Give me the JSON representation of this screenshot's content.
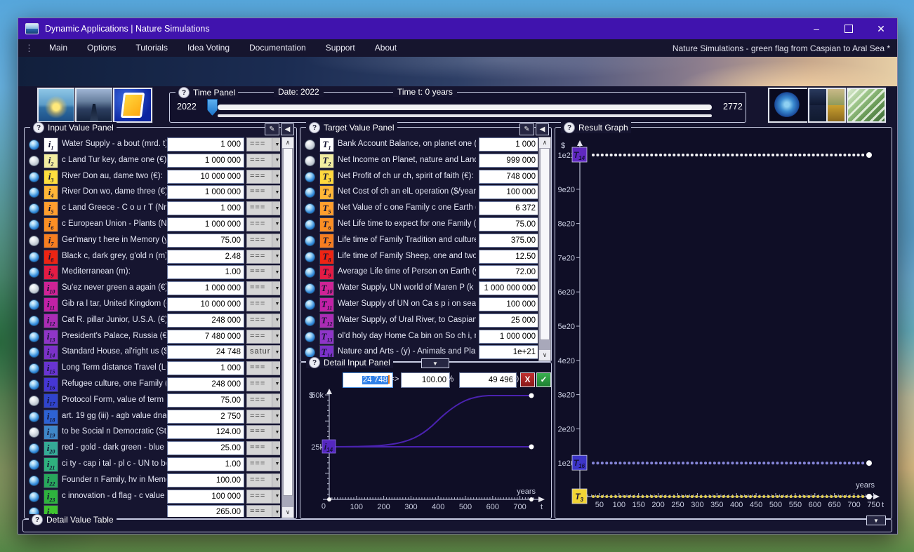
{
  "window": {
    "title": "Dynamic Applications | Nature Simulations",
    "controls": {
      "minimize": "–",
      "close": "✕"
    },
    "menu": {
      "items": [
        "Main",
        "Options",
        "Tutorials",
        "Idea Voting",
        "Documentation",
        "Support",
        "About"
      ],
      "right_text": "Nature Simulations - green flag from Caspian to Aral Sea *"
    }
  },
  "toolbar": {
    "left_thumbnails": [
      "sunset-sea-photo",
      "pier-photo",
      "dynamic-applications-logo"
    ],
    "right_thumbnails": [
      "earth-photo",
      "four-image-collage",
      "green-architecture-photo"
    ]
  },
  "time_panel": {
    "title": "Time Panel",
    "date": "Date: 2022",
    "time": "Time t: 0 years",
    "start": "2022",
    "end": "2772"
  },
  "input_panel": {
    "title": "Input Value Panel",
    "rows": [
      {
        "icon": "i",
        "index": 1,
        "color": "#ffffff",
        "label": "Water Supply - a bout (mrd. t):",
        "value": "1 000",
        "mode": "===",
        "selected": true
      },
      {
        "icon": "i",
        "index": 2,
        "color": "#f2eda0",
        "label": "c Land Tur key, dame one (€):",
        "value": "1 000 000",
        "mode": "===",
        "selected": false
      },
      {
        "icon": "i",
        "index": 3,
        "color": "#ffdf3e",
        "label": "River Don au, dame two (€):",
        "value": "10 000 000",
        "mode": "===",
        "selected": true
      },
      {
        "icon": "i",
        "index": 4,
        "color": "#ffb637",
        "label": "River Don wo, dame three (€):",
        "value": "1 000 000",
        "mode": "===",
        "selected": true
      },
      {
        "icon": "i",
        "index": 5,
        "color": "#ff9e2e",
        "label": "c Land Greece - C o u r T (Nr):",
        "value": "1 000",
        "mode": "===",
        "selected": true
      },
      {
        "icon": "i",
        "index": 6,
        "color": "#fb8f24",
        "label": "c European Union - Plants (Nr):",
        "value": "1 000 000",
        "mode": "===",
        "selected": true
      },
      {
        "icon": "i",
        "index": 7,
        "color": "#f57e20",
        "label": "Ger'many t here in Memory (year",
        "value": "75.00",
        "mode": "===",
        "selected": false
      },
      {
        "icon": "i",
        "index": 8,
        "color": "#ee2413",
        "label": "Black c, dark grey, g'old n (m):",
        "value": "2.48",
        "mode": "===",
        "selected": true
      },
      {
        "icon": "i",
        "index": 9,
        "color": "#e31b44",
        "label": "Mediterranean (m):",
        "value": "1.00",
        "mode": "===",
        "selected": true
      },
      {
        "icon": "i",
        "index": 10,
        "color": "#cf2396",
        "label": "Su'ez never green a again (€):",
        "value": "1 000 000",
        "mode": "===",
        "selected": false
      },
      {
        "icon": "i",
        "index": 11,
        "color": "#c221a6",
        "label": "Gib ra l tar, United Kingdom (€):",
        "value": "10 000 000",
        "mode": "===",
        "selected": true
      },
      {
        "icon": "i",
        "index": 12,
        "color": "#ab2cb5",
        "label": "Cat R. pillar Junior, U.S.A. (€):",
        "value": "248 000",
        "mode": "===",
        "selected": true
      },
      {
        "icon": "i",
        "index": 13,
        "color": "#8f35c8",
        "label": "President's Palace, Russia (€):",
        "value": "7 480 000",
        "mode": "===",
        "selected": true
      },
      {
        "icon": "i",
        "index": 14,
        "color": "#7c31c9",
        "label": "Standard House, al'right us ($):",
        "value": "24 748",
        "mode": "saturated?",
        "selected": true
      },
      {
        "icon": "i",
        "index": 15,
        "color": "#6934d2",
        "label": "Long Term distance Travel (Lu§",
        "value": "1 000",
        "mode": "===",
        "selected": true
      },
      {
        "icon": "i",
        "index": 16,
        "color": "#4636d4",
        "label": "Refugee culture, one Family (€):",
        "value": "248 000",
        "mode": "===",
        "selected": true
      },
      {
        "icon": "i",
        "index": 17,
        "color": "#3044cc",
        "label": "Protocol Form, value of term (€):",
        "value": "75.00",
        "mode": "===",
        "selected": false
      },
      {
        "icon": "i",
        "index": 18,
        "color": "#2d62d4",
        "label": "art. 19 gg (iii) - agb value dna (€)",
        "value": "2 750",
        "mode": "===",
        "selected": true
      },
      {
        "icon": "i",
        "index": 19,
        "color": "#3f87c8",
        "label": "to be Social n Democratic (State",
        "value": "124.00",
        "mode": "===",
        "selected": false
      },
      {
        "icon": "i",
        "index": 20,
        "color": "#35aa96",
        "label": "red - gold - dark green - blue (€):",
        "value": "25.00",
        "mode": "===",
        "selected": true
      },
      {
        "icon": "i",
        "index": 21,
        "color": "#2fb07e",
        "label": "ci ty - cap i tal - pl c - UN to be (",
        "value": "1.00",
        "mode": "===",
        "selected": true
      },
      {
        "icon": "i",
        "index": 22,
        "color": "#28a75c",
        "label": "Founder n Family, hv in Memory",
        "value": "100.00",
        "mode": "===",
        "selected": true
      },
      {
        "icon": "i",
        "index": 23,
        "color": "#2eb33e",
        "label": "c innovation - d flag - c value (€",
        "value": "100 000",
        "mode": "===",
        "selected": true
      },
      {
        "icon": "i",
        "index": 24,
        "color": "#3fc32f",
        "label": "",
        "value": "265.00",
        "mode": "===",
        "selected": true
      }
    ]
  },
  "target_panel": {
    "title": "Target Value Panel",
    "rows": [
      {
        "icon": "T",
        "index": 1,
        "color": "#ffffff",
        "label": "Bank Account Balance, on planet one (€):",
        "value": "1 000",
        "selected": false
      },
      {
        "icon": "T",
        "index": 2,
        "color": "#f2eda0",
        "label": "Net Income on Planet, nature and Land ($):",
        "value": "999 000",
        "selected": false
      },
      {
        "icon": "T",
        "index": 3,
        "color": "#ffd83e",
        "label": "Net Profit of ch ur ch, spirit of faith (€):",
        "value": "748 000",
        "selected": true
      },
      {
        "icon": "T",
        "index": 4,
        "color": "#ffb637",
        "label": "Net Cost of ch an elL operation ($/year):",
        "value": "100 000",
        "selected": true
      },
      {
        "icon": "T",
        "index": 5,
        "color": "#ff9e2e",
        "label": "Net Value of c one Family c one Earth (km):",
        "value": "6 372",
        "selected": true
      },
      {
        "icon": "T",
        "index": 6,
        "color": "#fb8f24",
        "label": "Net Life time to expect for one Family (y):",
        "value": "75.00",
        "selected": true
      },
      {
        "icon": "T",
        "index": 7,
        "color": "#f57e20",
        "label": "Life time of Family Tradition and culture (y):",
        "value": "375.00",
        "selected": true
      },
      {
        "icon": "T",
        "index": 8,
        "color": "#ee2413",
        "label": "Life time of Family Sheep, one and two (y):",
        "value": "12.50",
        "selected": true
      },
      {
        "icon": "T",
        "index": 9,
        "color": "#e31b44",
        "label": "Average Life time of Person on Earth (y):",
        "value": "72.00",
        "selected": true
      },
      {
        "icon": "T",
        "index": 10,
        "color": "#cf2396",
        "label": "Water Supply, UN world of Maren P (k g ton",
        "value": "1 000 000 000",
        "selected": true
      },
      {
        "icon": "T",
        "index": 11,
        "color": "#c221a6",
        "label": "Water Supply of UN on Ca s p i on sea (k g",
        "value": "100 000",
        "selected": true
      },
      {
        "icon": "T",
        "index": 12,
        "color": "#ab2cb5",
        "label": "Water Supply, of Ural River, to Caspian Sea",
        "value": "25 000",
        "selected": true
      },
      {
        "icon": "T",
        "index": 13,
        "color": "#8f35c8",
        "label": "ol'd holy day Home Ca bin on So ch i, n.a. (F",
        "value": "1 000 000",
        "selected": true
      },
      {
        "icon": "T",
        "index": 14,
        "color": "#7c31c9",
        "label": "Nature and Arts - (y) - Animals and Plants ($",
        "value": "1e+21",
        "selected": true
      }
    ]
  },
  "detail_input_panel": {
    "title": "Detail Input Panel",
    "value": "24 748",
    "maps_to": "=>",
    "percent": "100.00",
    "percent_unit": "%",
    "result": "49 496",
    "result_unit": "(•)",
    "cancel_label": "X",
    "confirm_label": "✓",
    "chart": {
      "type": "line",
      "ylabel": "$",
      "yticks": [
        "50k",
        "25k",
        "0"
      ],
      "xticks": [
        100,
        200,
        300,
        400,
        500,
        600,
        700
      ],
      "xlabel": "years",
      "x_var": "t",
      "marker": {
        "label_main": "i",
        "label_sub": "14",
        "color": "#5527c0"
      },
      "curve_start": "24 748",
      "curve_end": "49 496",
      "t_end": 750,
      "line_color": "#4a22b0"
    }
  },
  "result_graph": {
    "title": "Result Graph",
    "chart_data": {
      "type": "scatter",
      "ylabel": "$",
      "xlabel": "years",
      "x_var": "t",
      "yticks": [
        "1e21",
        "9e20",
        "8e20",
        "7e20",
        "6e20",
        "5e20",
        "4e20",
        "3e20",
        "2e20",
        "1e20"
      ],
      "xticks": [
        50,
        100,
        150,
        200,
        250,
        300,
        350,
        400,
        450,
        500,
        550,
        600,
        650,
        700,
        750
      ],
      "x_range_years": [
        0,
        750
      ],
      "series": [
        {
          "marker_main": "T",
          "marker_sub": "14",
          "value": "1e+21",
          "marker_color": "#6028c0",
          "dot_color": "#f2f2f6"
        },
        {
          "marker_main": "T",
          "marker_sub": "16",
          "value": "1e+20",
          "marker_color": "#3c35c8",
          "dot_color": "#8585d8"
        },
        {
          "marker_main": "T",
          "marker_sub": "3",
          "value": "748 000",
          "marker_color": "#f2d435",
          "dot_color": "#ddca4e"
        }
      ]
    }
  },
  "detail_value_table": {
    "title": "Detail Value Table"
  }
}
